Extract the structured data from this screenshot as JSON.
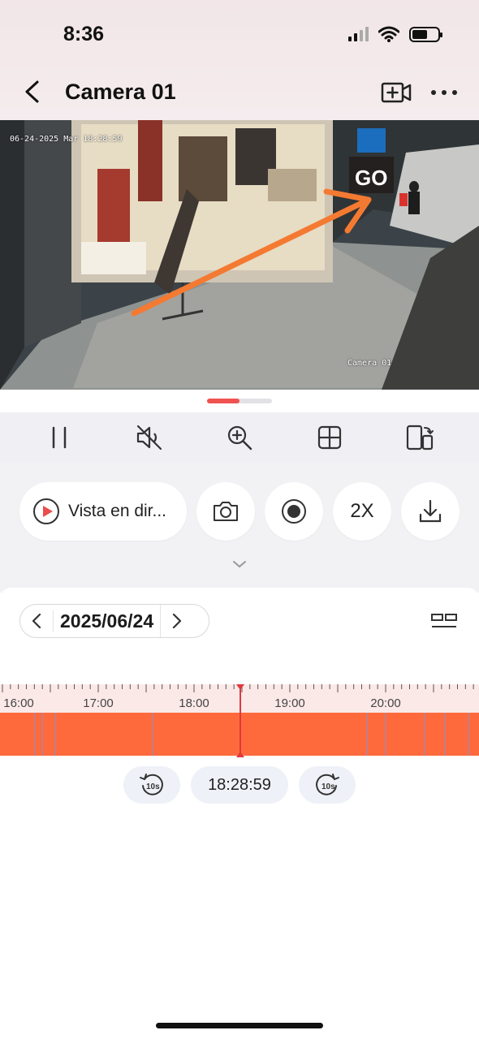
{
  "status_bar": {
    "time": "8:36",
    "battery_level": 0.6
  },
  "nav": {
    "title": "Camera 01",
    "back_icon": "chevron-left-icon",
    "record_icon": "video-plus-icon",
    "more_icon": "more-horizontal-icon"
  },
  "video": {
    "osd_datetime": "06-24-2025 Mar 18:28:59",
    "osd_camera_name": "Camera 01",
    "store_sign": "GO",
    "annotation": "orange-arrow",
    "annotation_color": "#f47a32"
  },
  "toolbar": {
    "items": [
      "pause-icon",
      "mute-icon",
      "zoom-in-icon",
      "grid-icon",
      "rotate-screen-icon"
    ]
  },
  "controls": {
    "live_label": "Vista en dir...",
    "speed_label": "2X",
    "snapshot_icon": "camera-icon",
    "record_icon": "record-icon",
    "download_icon": "download-icon"
  },
  "date": {
    "value": "2025/06/24"
  },
  "timeline": {
    "hour_labels": [
      "16:00",
      "17:00",
      "18:00",
      "19:00",
      "20:00"
    ],
    "current_time": "18:28:59",
    "recording_color": "#ff6a3d",
    "playhead_color": "#e0383e"
  },
  "playback": {
    "time": "18:28:59",
    "rewind_label": "10s",
    "forward_label": "10s"
  },
  "colors": {
    "accent": "#e94d4d",
    "background": "#f2f2f4"
  }
}
